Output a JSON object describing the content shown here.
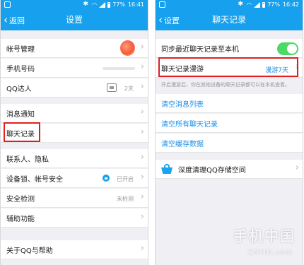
{
  "status_bar": {
    "battery": "77%",
    "left_time": "16:41",
    "right_time": "16:42"
  },
  "settings_screen": {
    "title": "设置",
    "back_label": "返回",
    "items": {
      "account": "帐号管理",
      "phone": "手机号码",
      "qq_daren": "QQ达人",
      "qq_daren_value": "2天",
      "notifications": "消息通知",
      "chat_history": "聊天记录",
      "contacts_privacy": "联系人、隐私",
      "device_lock": "设备锁、帐号安全",
      "device_lock_value": "已开启",
      "security_check": "安全检测",
      "security_check_value": "未检测",
      "accessibility": "辅助功能",
      "about_help": "关于QQ与帮助"
    }
  },
  "chat_history_screen": {
    "title": "聊天记录",
    "back_label": "设置",
    "sync_recent": "同步最近聊天记录至本机",
    "sync_enabled": true,
    "roaming": "聊天记录漫游",
    "roaming_value": "漫游7天",
    "roaming_hint": "开启漫游后，你在其他设备的聊天记录都可以在本机查看。",
    "clear_message_list": "清空消息列表",
    "clear_all_history": "清空所有聊天记录",
    "clear_cache": "清空缓存数据",
    "deep_clean": "深度清理QQ存储空间"
  },
  "watermark": {
    "main": "手机中国",
    "sub": "CNMO.com"
  },
  "colors": {
    "accent": "#16a0ee",
    "link": "#1a8ee8",
    "toggle_on": "#4cd964",
    "highlight": "#e02020"
  }
}
